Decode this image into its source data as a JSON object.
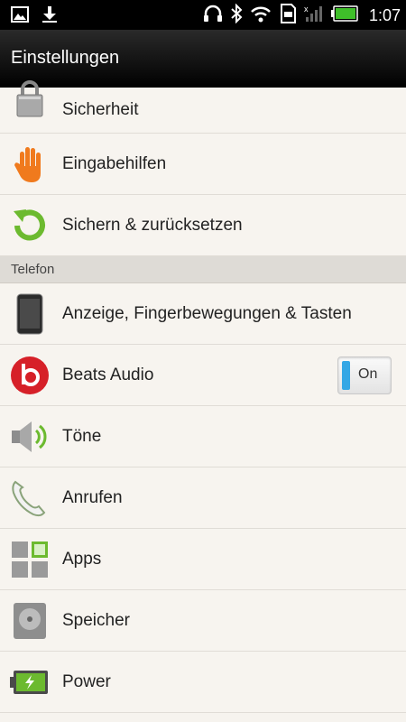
{
  "statusbar": {
    "time": "1:07",
    "left_icons": [
      "image-icon",
      "download-icon"
    ],
    "right_icons": [
      "headphones-icon",
      "bluetooth-icon",
      "wifi-icon",
      "sd-card-icon",
      "signal-icon",
      "battery-icon"
    ]
  },
  "header": {
    "title": "Einstellungen"
  },
  "list": {
    "items": [
      {
        "label": "Sicherheit",
        "icon": "lock-icon"
      },
      {
        "label": "Eingabehilfen",
        "icon": "hand-icon"
      },
      {
        "label": "Sichern & zurücksetzen",
        "icon": "refresh-icon"
      }
    ],
    "section_title": "Telefon",
    "phone_items": [
      {
        "label": "Anzeige, Fingerbewegungen & Tasten",
        "icon": "phone-icon"
      },
      {
        "label": "Beats Audio",
        "icon": "beats-icon",
        "toggle": "On"
      },
      {
        "label": "Töne",
        "icon": "speaker-icon"
      },
      {
        "label": "Anrufen",
        "icon": "handset-icon"
      },
      {
        "label": "Apps",
        "icon": "apps-icon"
      },
      {
        "label": "Speicher",
        "icon": "storage-icon"
      },
      {
        "label": "Power",
        "icon": "battery-power-icon"
      }
    ]
  },
  "colors": {
    "accent": "#34a7e5",
    "header": "#111111",
    "background": "#f6f3ee",
    "section": "#dedbd6"
  }
}
